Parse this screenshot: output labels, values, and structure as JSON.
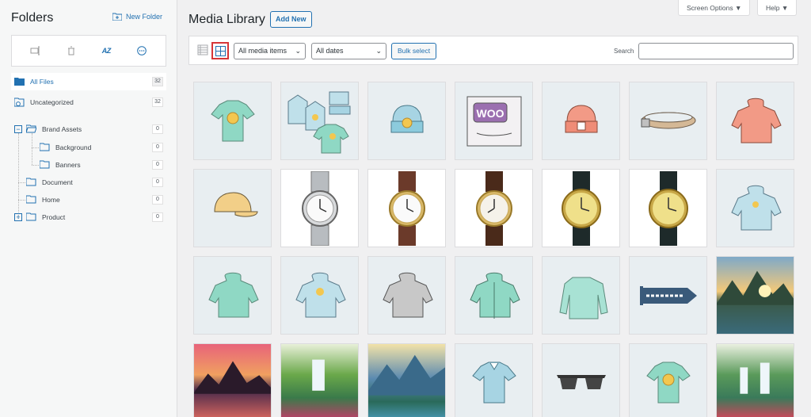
{
  "sidebar": {
    "title": "Folders",
    "new_folder_label": "New Folder",
    "toolbar_icons": [
      "rename-icon",
      "delete-icon",
      "sort-az-icon",
      "more-icon"
    ],
    "az_label": "AZ",
    "folders": [
      {
        "label": "All Files",
        "count": "32"
      },
      {
        "label": "Uncategorized",
        "count": "32"
      },
      {
        "label": "Brand Assets",
        "count": "0"
      },
      {
        "label": "Background",
        "count": "0"
      },
      {
        "label": "Banners",
        "count": "0"
      },
      {
        "label": "Document",
        "count": "0"
      },
      {
        "label": "Home",
        "count": "0"
      },
      {
        "label": "Product",
        "count": "0"
      }
    ]
  },
  "header": {
    "title": "Media Library",
    "add_new_label": "Add New",
    "screen_options_label": "Screen Options ▼",
    "help_label": "Help ▼"
  },
  "filters": {
    "media_type": "All media items",
    "dates": "All dates",
    "bulk_label": "Bulk select",
    "search_label": "Search",
    "search_value": ""
  },
  "media_items": [
    {
      "type": "tshirt-logo",
      "bg": "light"
    },
    {
      "type": "hoodie-set",
      "bg": "light"
    },
    {
      "type": "beanie-logo",
      "bg": "light"
    },
    {
      "type": "woo-album",
      "bg": "light"
    },
    {
      "type": "beanie-orange",
      "bg": "light"
    },
    {
      "type": "belt",
      "bg": "light"
    },
    {
      "type": "hoodie-orange",
      "bg": "light"
    },
    {
      "type": "cap",
      "bg": "light"
    },
    {
      "type": "watch-steel",
      "bg": "white"
    },
    {
      "type": "watch-brown",
      "bg": "white"
    },
    {
      "type": "watch-brown2",
      "bg": "white"
    },
    {
      "type": "watch-gold",
      "bg": "white"
    },
    {
      "type": "watch-gold2",
      "bg": "white"
    },
    {
      "type": "hoodie-logo-blue",
      "bg": "light"
    },
    {
      "type": "hoodie-green",
      "bg": "light"
    },
    {
      "type": "hoodie-logo-blue2",
      "bg": "light"
    },
    {
      "type": "hoodie-grey",
      "bg": "light"
    },
    {
      "type": "hoodie-zip",
      "bg": "light"
    },
    {
      "type": "longsleeve",
      "bg": "light"
    },
    {
      "type": "pennant",
      "bg": "light"
    },
    {
      "type": "landscape-lake",
      "bg": "photo"
    },
    {
      "type": "landscape-sunset",
      "bg": "photo"
    },
    {
      "type": "landscape-waterfall",
      "bg": "photo"
    },
    {
      "type": "landscape-mountains",
      "bg": "photo"
    },
    {
      "type": "polo",
      "bg": "light"
    },
    {
      "type": "sunglasses",
      "bg": "light"
    },
    {
      "type": "tshirt-logo2",
      "bg": "light"
    },
    {
      "type": "landscape-waterfall2",
      "bg": "photo"
    }
  ]
}
